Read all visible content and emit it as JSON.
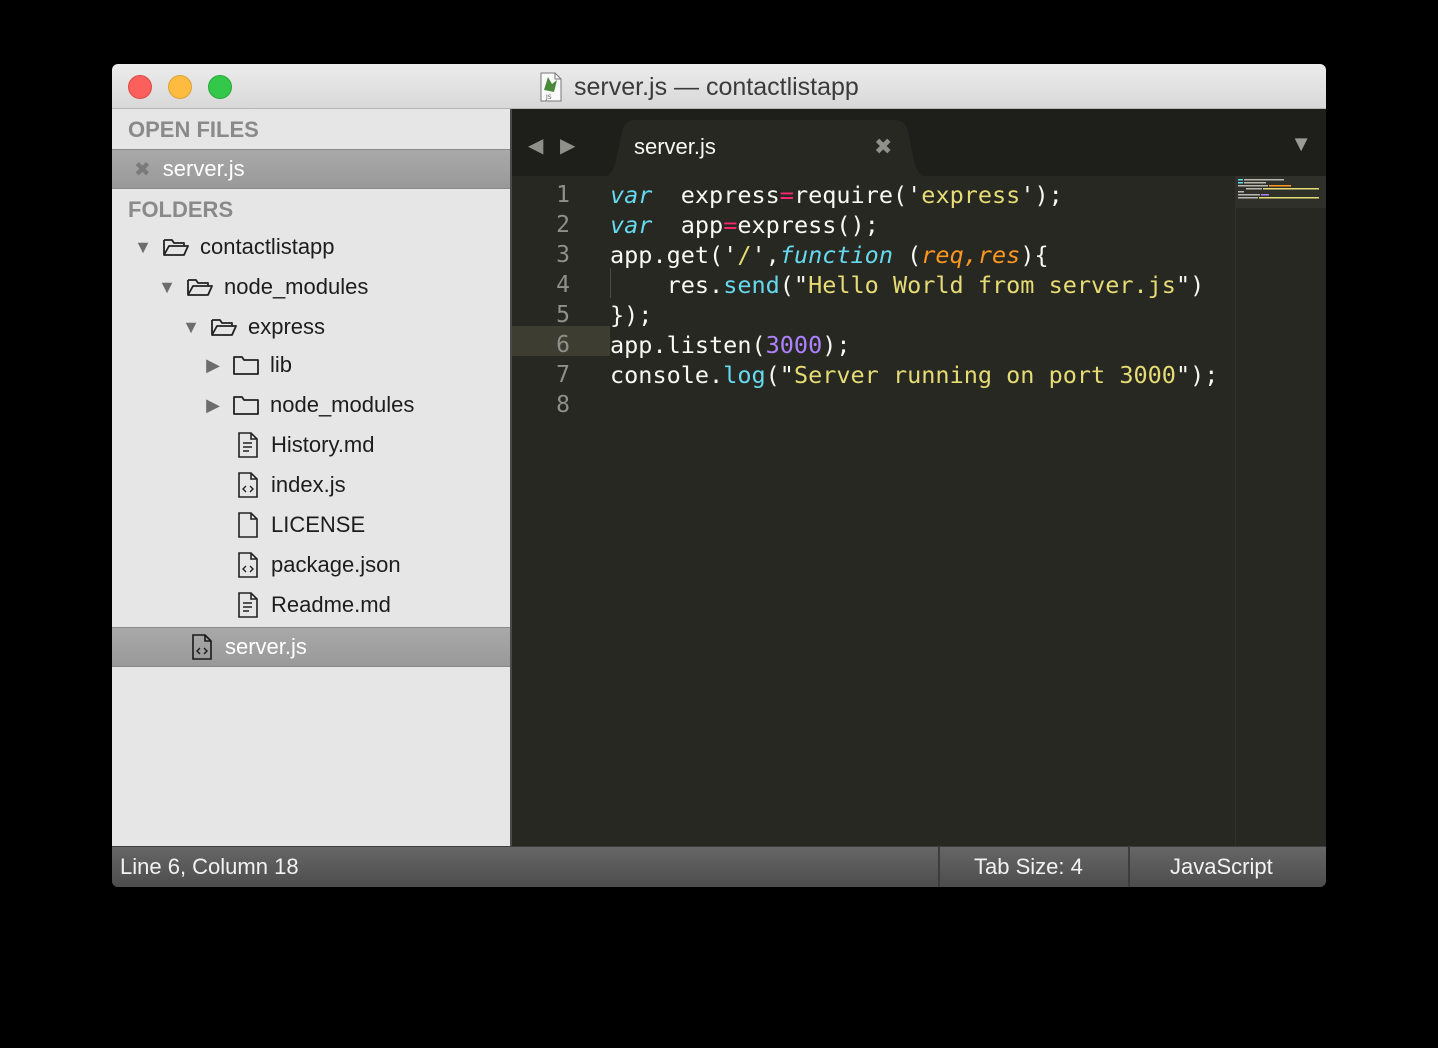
{
  "window": {
    "title": "server.js — contactlistapp"
  },
  "sidebar": {
    "open_files_title": "OPEN FILES",
    "open_files": [
      {
        "label": "server.js",
        "close_icon": "close-icon"
      }
    ],
    "folders_title": "FOLDERS",
    "tree": [
      {
        "label": "contactlistapp",
        "type": "folder",
        "expanded": true
      },
      {
        "label": "node_modules",
        "type": "folder",
        "expanded": true
      },
      {
        "label": "express",
        "type": "folder",
        "expanded": true
      },
      {
        "label": "lib",
        "type": "folder",
        "expanded": false
      },
      {
        "label": "node_modules",
        "type": "folder",
        "expanded": false
      },
      {
        "label": "History.md",
        "type": "file",
        "icon": "text-file-icon"
      },
      {
        "label": "index.js",
        "type": "file",
        "icon": "code-file-icon"
      },
      {
        "label": "LICENSE",
        "type": "file",
        "icon": "file-icon"
      },
      {
        "label": "package.json",
        "type": "file",
        "icon": "code-file-icon"
      },
      {
        "label": "Readme.md",
        "type": "file",
        "icon": "text-file-icon"
      },
      {
        "label": "server.js",
        "type": "file",
        "icon": "code-file-icon",
        "selected": true
      }
    ]
  },
  "tabs": [
    {
      "label": "server.js",
      "active": true
    }
  ],
  "editor": {
    "line_numbers": [
      "1",
      "2",
      "3",
      "4",
      "5",
      "6",
      "7",
      "8"
    ],
    "current_line": 6,
    "lines": [
      [
        [
          "kw",
          "var"
        ],
        [
          "",
          "  express"
        ],
        [
          "op",
          "="
        ],
        [
          "",
          "require('"
        ],
        [
          "str",
          "express"
        ],
        [
          "",
          "');"
        ]
      ],
      [
        [
          "kw",
          "var"
        ],
        [
          "",
          "  app"
        ],
        [
          "op",
          "="
        ],
        [
          "",
          "express();"
        ]
      ],
      [
        [
          "",
          "app.get('"
        ],
        [
          "str",
          "/"
        ],
        [
          "",
          "',"
        ],
        [
          "kw",
          "function"
        ],
        [
          "",
          " ("
        ],
        [
          "param",
          "req,res"
        ],
        [
          "",
          "){"
        ]
      ],
      [
        [
          "",
          "    res."
        ],
        [
          "fn",
          "send"
        ],
        [
          "",
          "(\""
        ],
        [
          "str",
          "Hello World from server.js"
        ],
        [
          "",
          "\")"
        ]
      ],
      [
        [
          "",
          "});"
        ]
      ],
      [
        [
          "",
          "app.listen("
        ],
        [
          "num",
          "3000"
        ],
        [
          "",
          ");"
        ]
      ],
      [
        [
          "",
          "console."
        ],
        [
          "fn",
          "log"
        ],
        [
          "",
          "(\""
        ],
        [
          "str",
          "Server running on port 3000"
        ],
        [
          "",
          "\");"
        ]
      ],
      [
        [
          "",
          ""
        ]
      ]
    ]
  },
  "status": {
    "position": "Line 6, Column 18",
    "tab_size": "Tab Size: 4",
    "syntax": "JavaScript"
  },
  "colors": {
    "editor_bg": "#272822",
    "keyword": "#66d9ef",
    "operator": "#f92672",
    "string": "#e6db74",
    "number": "#ae81ff",
    "parameter": "#fd971f"
  }
}
